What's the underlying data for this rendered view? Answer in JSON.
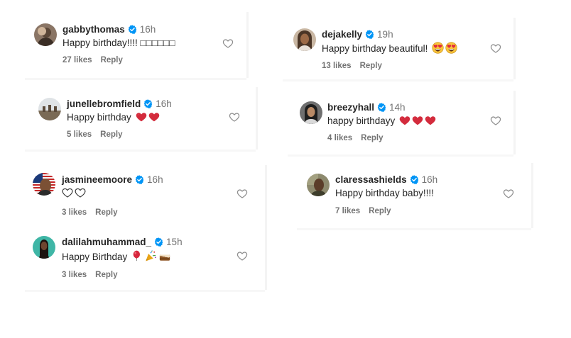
{
  "comments": [
    {
      "username": "gabbythomas",
      "time": "16h",
      "text": "Happy birthday!!!! □□□□□□",
      "likes": "27 likes",
      "reply": "Reply"
    },
    {
      "username": "dejakelly",
      "time": "19h",
      "text": "Happy birthday beautiful!",
      "likes": "13 likes",
      "reply": "Reply"
    },
    {
      "username": "junellebromfield",
      "time": "16h",
      "text": "Happy birthday",
      "likes": "5 likes",
      "reply": "Reply"
    },
    {
      "username": "breezyhall",
      "time": "14h",
      "text": "happy birthdayy",
      "likes": "4 likes",
      "reply": "Reply"
    },
    {
      "username": "jasmineemoore",
      "time": "16h",
      "text": "",
      "likes": "3 likes",
      "reply": "Reply"
    },
    {
      "username": "claressashields",
      "time": "16h",
      "text": "Happy birthday baby!!!!",
      "likes": "7 likes",
      "reply": "Reply"
    },
    {
      "username": "dalilahmuhammad_",
      "time": "15h",
      "text": "Happy Birthday",
      "likes": "3 likes",
      "reply": "Reply"
    }
  ],
  "icons": {
    "verified": "verified-badge-icon",
    "like": "heart-outline-icon",
    "emoji_heart": "red-heart-emoji",
    "emoji_heart_eyes": "heart-eyes-emoji",
    "emoji_white_heart": "white-heart-emoji",
    "emoji_balloon": "balloon-emoji",
    "emoji_party": "party-popper-emoji",
    "emoji_cake": "cake-emoji"
  },
  "colors": {
    "verified_blue": "#0095f6",
    "text": "#262626",
    "secondary_text": "#737373",
    "heart_red": "#e0245e"
  }
}
